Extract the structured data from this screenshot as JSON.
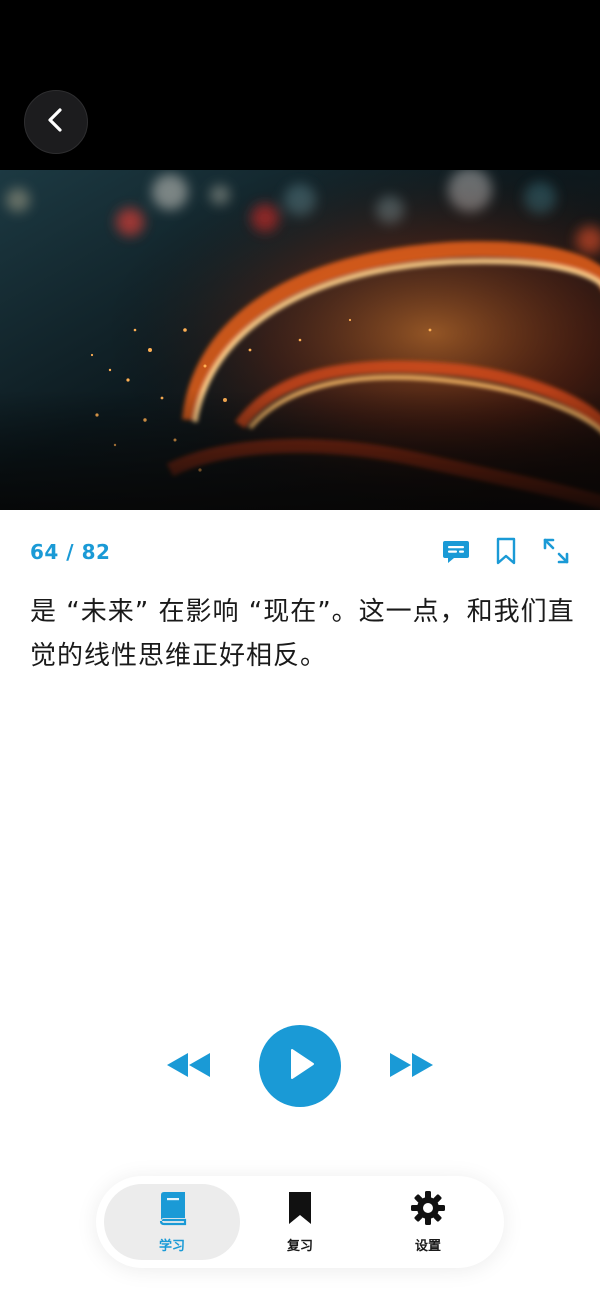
{
  "header": {
    "back_icon": "chevron-left-icon"
  },
  "hero": {
    "image_description": "light-trail-sparks"
  },
  "card": {
    "counter": "64 / 82",
    "sentence": "是 “未来” 在影响 “现在”。这一点，和我们直觉的线性思维正好相反。",
    "tools": [
      "subtitle-icon",
      "bookmark-icon",
      "expand-icon"
    ]
  },
  "player": {
    "prev_icon": "rewind-icon",
    "play_icon": "play-icon",
    "next_icon": "fast-forward-icon"
  },
  "tabbar": {
    "items": [
      {
        "label": "学习",
        "icon": "book-icon",
        "active": true
      },
      {
        "label": "复习",
        "icon": "bookmark-icon",
        "active": false
      },
      {
        "label": "设置",
        "icon": "gear-icon",
        "active": false
      }
    ]
  },
  "colors": {
    "accent": "#1a9ad6",
    "text": "#1a1a1a",
    "header_bg": "#000000"
  }
}
